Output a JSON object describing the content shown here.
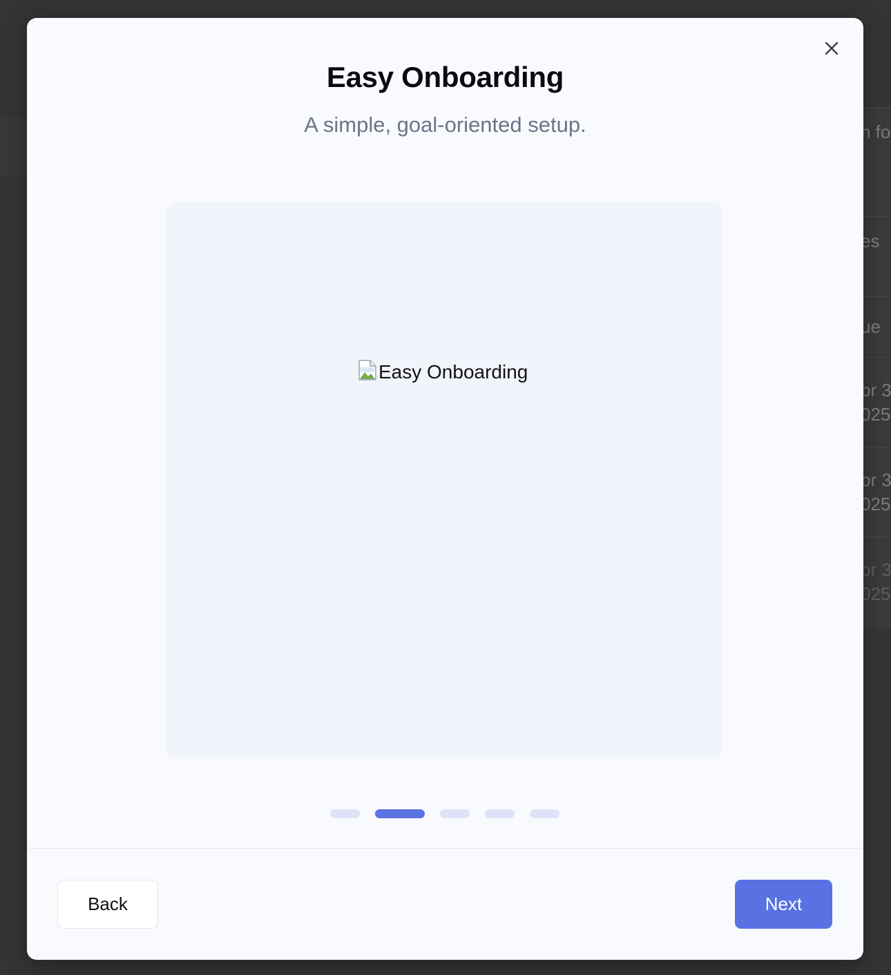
{
  "background": {
    "rows": [
      "h fo",
      "es",
      "ue",
      "pr 3\n025",
      "pr 3\n025",
      "pr 3\n025"
    ]
  },
  "modal": {
    "title": "Easy Onboarding",
    "subtitle": "A simple, goal-oriented setup.",
    "image_alt": "Easy Onboarding",
    "close_icon": "close-icon",
    "steps": {
      "total": 5,
      "current": 2
    },
    "back_label": "Back",
    "next_label": "Next"
  },
  "colors": {
    "accent": "#5872e4",
    "dot_inactive": "#dfe3f7",
    "backdrop": "#343434"
  }
}
